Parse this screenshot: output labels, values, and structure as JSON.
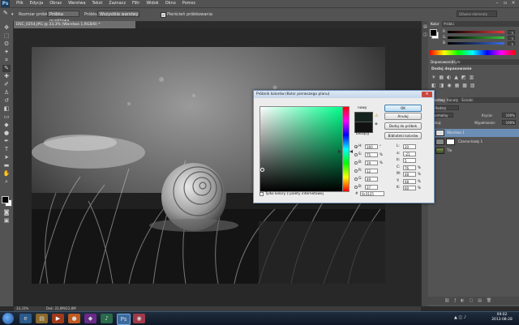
{
  "app": {
    "logo": "Ps"
  },
  "menu": [
    "Plik",
    "Edycja",
    "Obraz",
    "Warstwa",
    "Tekst",
    "Zaznacz",
    "Filtr",
    "Widok",
    "Okno",
    "Pomoc"
  ],
  "options_bar": {
    "sample_size_label": "Rozmiar próbki:",
    "sample_size_value": "Próbka punktowa",
    "sample_label": "Próbkuj:",
    "sample_value": "Wszystkie warstwy",
    "ring_label": "Pierścień próbkowania",
    "search_placeholder": "Główne elementy"
  },
  "document": {
    "tab_title": "DSC_0254.JPG @ 33,3% (Warstwa 1,RGB/8) *",
    "zoom": "33,33%",
    "doc_info": "Dok: 22,8M/22,8M"
  },
  "panels": {
    "color_tabs": [
      "Kolor",
      "Próbki"
    ],
    "color_rows": [
      {
        "label": "R",
        "value": "0",
        "color": "#e23a3a"
      },
      {
        "label": "G",
        "value": "0",
        "color": "#3ac43a"
      },
      {
        "label": "B",
        "value": "0",
        "color": "#3a6ee2"
      }
    ],
    "adjust_tabs": [
      "Dopasowania",
      "Style"
    ],
    "adjust_title": "Dodaj dopasowanie",
    "layers_tabs": [
      "Warstwy",
      "Kanały",
      "Ścieżki"
    ],
    "blend_mode": "Normalny",
    "opacity_label": "Krycie:",
    "opacity_value": "100%",
    "fill_label": "Wypełnienie:",
    "fill_value": "100%",
    "lock_label": "Blokuj:",
    "layers": [
      {
        "name": "Warstwa 1",
        "selected": true
      },
      {
        "name": "Czarno-biały 1",
        "selected": false
      },
      {
        "name": "Tło",
        "selected": false
      }
    ]
  },
  "dialog": {
    "title": "Próbnik kolorów (Kolor pierwszego planu)",
    "close": "×",
    "new_label": "nowy",
    "current_label": "bieżący",
    "buttons": [
      "OK",
      "Anuluj",
      "Dodaj do próbek",
      "Biblioteki kolorów"
    ],
    "web_only_label": "Tylko kolory z palety internetowej",
    "fields_left": [
      {
        "label": "H:",
        "value": "160",
        "unit": "°",
        "selected": true
      },
      {
        "label": "S:",
        "value": "75",
        "unit": "%",
        "selected": false
      },
      {
        "label": "B:",
        "value": "19",
        "unit": "%",
        "selected": false
      },
      {
        "label": "R:",
        "value": "12",
        "unit": "",
        "selected": false
      },
      {
        "label": "G:",
        "value": "49",
        "unit": "",
        "selected": false
      },
      {
        "label": "B:",
        "value": "37",
        "unit": "",
        "selected": false
      }
    ],
    "fields_right": [
      {
        "label": "L:",
        "value": "20",
        "unit": ""
      },
      {
        "label": "a:",
        "value": "-21",
        "unit": ""
      },
      {
        "label": "b:",
        "value": "5",
        "unit": ""
      },
      {
        "label": "C:",
        "value": "76",
        "unit": "%"
      },
      {
        "label": "M:",
        "value": "48",
        "unit": "%"
      },
      {
        "label": "Y:",
        "value": "68",
        "unit": "%"
      },
      {
        "label": "K:",
        "value": "60",
        "unit": "%"
      }
    ],
    "hex_label": "#",
    "hex_value": "0c3125"
  },
  "taskbar": {
    "time": "09:02",
    "date": "2013-08-28"
  }
}
